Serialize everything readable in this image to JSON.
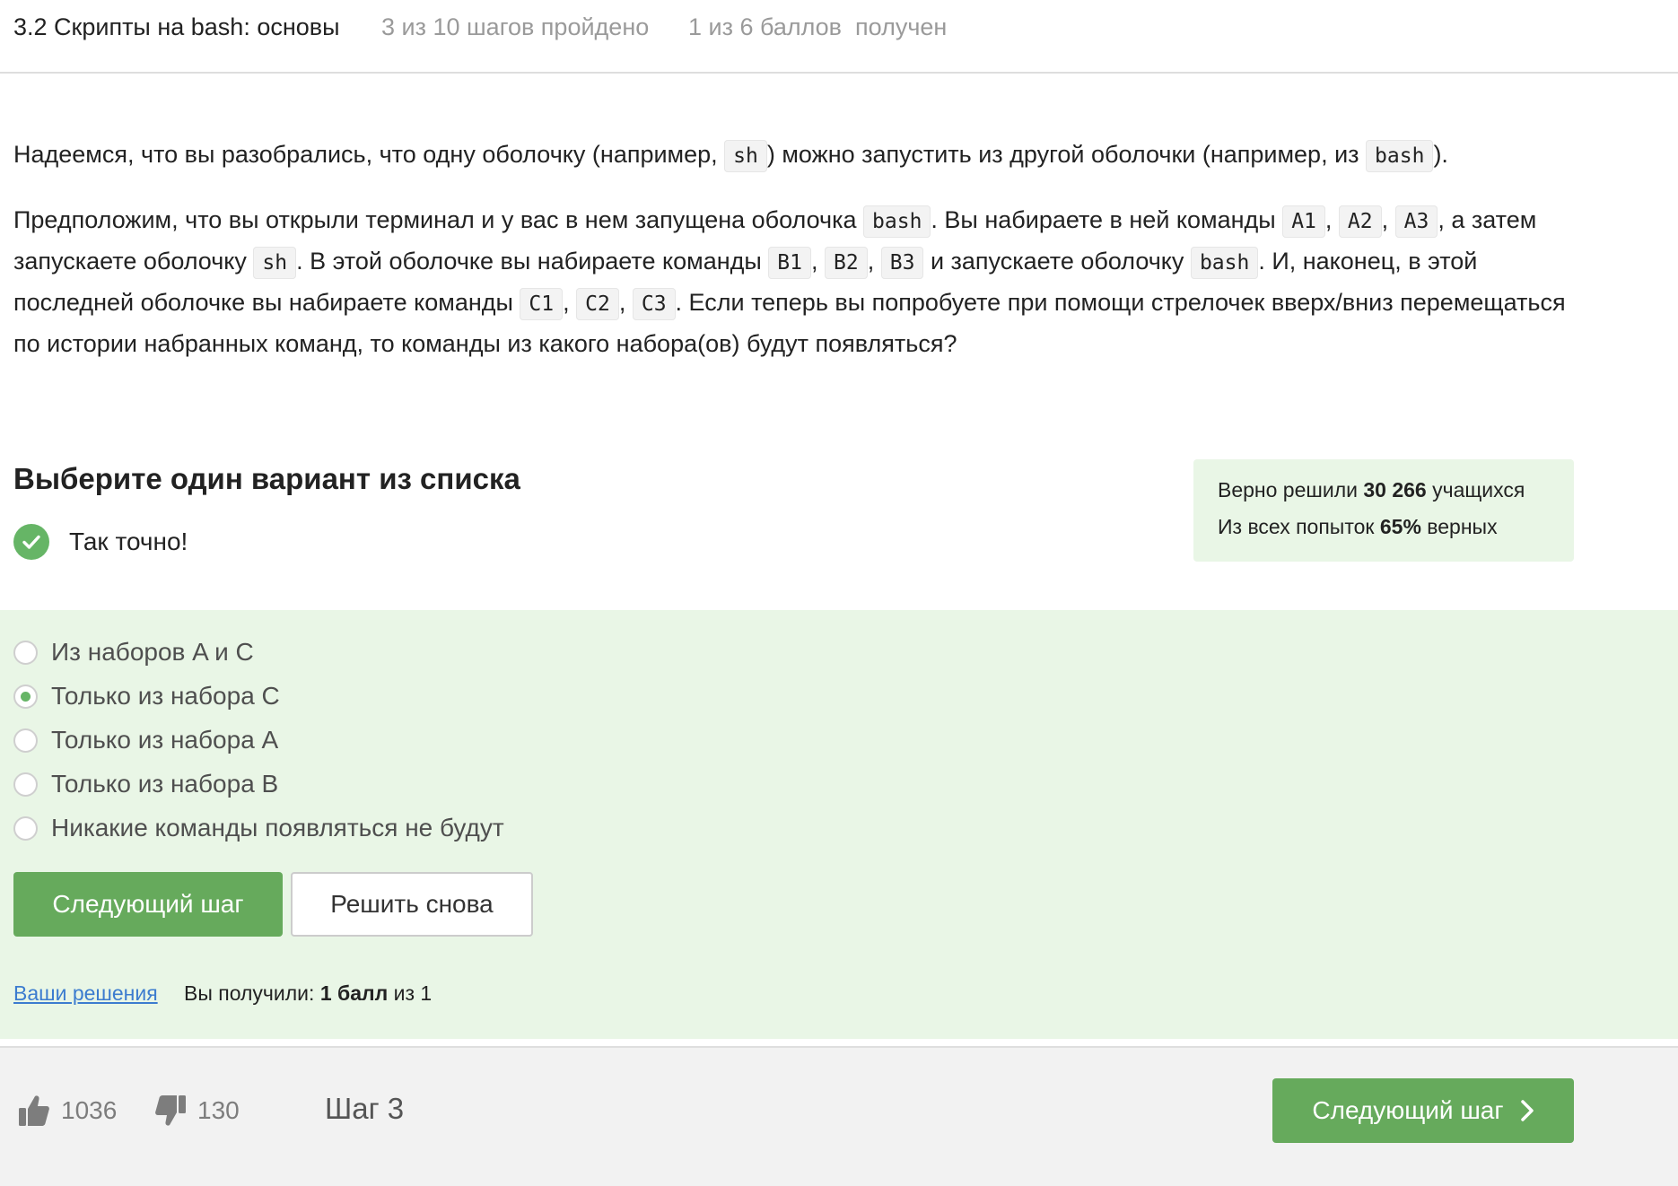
{
  "header": {
    "lesson_title": "3.2 Скрипты на bash: основы",
    "steps_progress": "3 из 10 шагов пройдено",
    "points_progress": "1 из 6 баллов  получен"
  },
  "content": {
    "p1": {
      "t1": "Надеемся, что вы разобрались, что одну оболочку (например, ",
      "c1": "sh",
      "t2": ") можно запустить из другой оболочки (например, из ",
      "c2": "bash",
      "t3": ")."
    },
    "p2": {
      "t1": "Предположим, что вы открыли терминал и у вас в нем запущена оболочка ",
      "c1": "bash",
      "t2": ". Вы набираете в ней команды ",
      "a1": "A1",
      "s1": ", ",
      "a2": "A2",
      "s2": ", ",
      "a3": "A3",
      "t3": ", а затем запускаете оболочку ",
      "c2": "sh",
      "t4": ". В этой оболочке вы набираете команды ",
      "b1": "B1",
      "s3": ", ",
      "b2": "B2",
      "s4": ", ",
      "b3": "B3",
      "t5": " и запускаете оболочку ",
      "c3": "bash",
      "t6": ". И, наконец, в этой последней оболочке вы набираете команды ",
      "cc1": "C1",
      "s5": ", ",
      "cc2": "C2",
      "s6": ", ",
      "cc3": "C3",
      "t7": ". Если теперь вы попробуете при помощи стрелочек вверх/вниз перемещаться по истории набранных команд, то команды из какого набора(ов) будут появляться?"
    }
  },
  "quiz": {
    "heading": "Выберите один вариант из списка",
    "feedback": "Так точно!",
    "options": [
      {
        "label": "Из наборов A и C",
        "checked": false
      },
      {
        "label": "Только из набора C",
        "checked": true
      },
      {
        "label": "Только из набора A",
        "checked": false
      },
      {
        "label": "Только из набора B",
        "checked": false
      },
      {
        "label": "Никакие команды появляться не будут",
        "checked": false
      }
    ],
    "next_button": "Следующий шаг",
    "retry_button": "Решить снова",
    "solutions_link": "Ваши решения",
    "result_prefix": "Вы получили: ",
    "result_points": "1 балл",
    "result_suffix": " из 1"
  },
  "stats": {
    "solved_prefix": "Верно решили ",
    "solved_count": "30 266",
    "solved_suffix": " учащихся",
    "attempts_prefix": "Из всех попыток ",
    "attempts_percent": "65%",
    "attempts_suffix": " верных"
  },
  "footer": {
    "likes": "1036",
    "dislikes": "130",
    "step_label": "Шаг 3",
    "next_button": "Следующий шаг"
  },
  "colors": {
    "accent_green": "#66aa5c",
    "answer_bg": "#e9f6e6",
    "link_blue": "#3c7ccf"
  }
}
